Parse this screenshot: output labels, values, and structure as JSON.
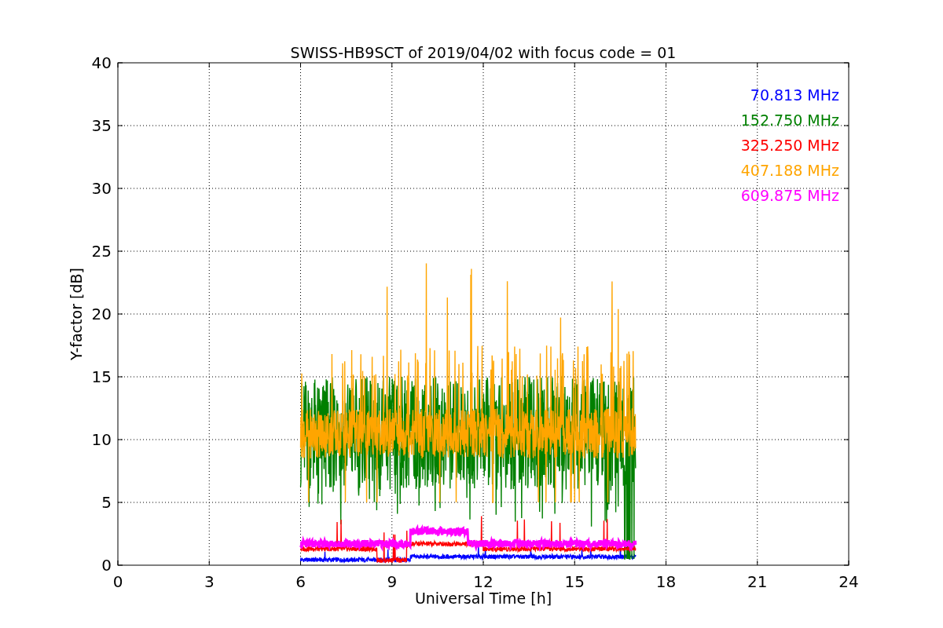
{
  "title": "SWISS-HB9SCT of 2019/04/02 with focus code = 01",
  "plot": {
    "xlabel": "Universal Time [h]",
    "ylabel": "Y-factor [dB]",
    "xticks": [
      "0",
      "3",
      "6",
      "9",
      "12",
      "15",
      "18",
      "21",
      "24"
    ],
    "yticks": [
      "40",
      "35",
      "30",
      "25",
      "20",
      "15",
      "10",
      "5",
      "0"
    ],
    "legend": [
      {
        "label": "70.813 MHz",
        "color": "#0000ff"
      },
      {
        "label": "152.750 MHz",
        "color": "#008000"
      },
      {
        "label": "325.250 MHz",
        "color": "#ff0000"
      },
      {
        "label": "407.188 MHz",
        "color": "#ffa500"
      },
      {
        "label": "609.875 MHz",
        "color": "#ff00ff"
      }
    ]
  }
}
